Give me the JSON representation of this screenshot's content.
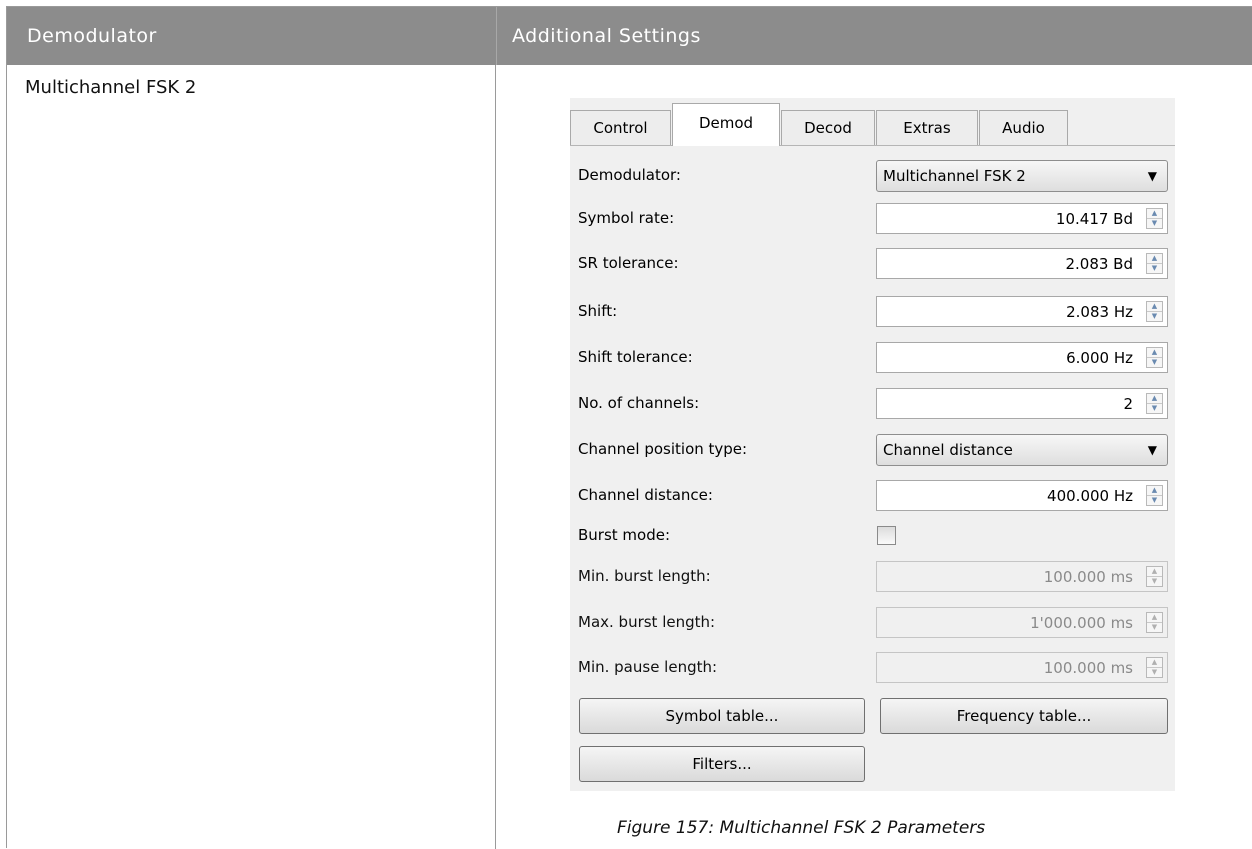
{
  "table": {
    "headers": [
      "Demodulator",
      "Additional Settings"
    ],
    "demodulator_name": "Multichannel FSK 2"
  },
  "tabs": [
    "Control",
    "Demod",
    "Decod",
    "Extras",
    "Audio"
  ],
  "active_tab": "Demod",
  "params": [
    {
      "label": "Demodulator:",
      "type": "combo",
      "value": "Multichannel FSK 2",
      "enabled": true
    },
    {
      "label": "Symbol rate:",
      "type": "spin",
      "value": "10.417 Bd",
      "enabled": true
    },
    {
      "label": "SR tolerance:",
      "type": "spin",
      "value": "2.083 Bd",
      "enabled": true
    },
    {
      "label": "Shift:",
      "type": "spin",
      "value": "2.083 Hz",
      "enabled": true
    },
    {
      "label": "Shift tolerance:",
      "type": "spin",
      "value": "6.000 Hz",
      "enabled": true
    },
    {
      "label": "No. of channels:",
      "type": "spin",
      "value": "2",
      "enabled": true
    },
    {
      "label": "Channel position type:",
      "type": "combo",
      "value": "Channel distance",
      "enabled": true
    },
    {
      "label": "Channel distance:",
      "type": "spin",
      "value": "400.000 Hz",
      "enabled": true
    },
    {
      "label": "Burst mode:",
      "type": "checkbox",
      "checked": false,
      "enabled": true
    },
    {
      "label": "Min. burst length:",
      "type": "spin",
      "value": "100.000 ms",
      "enabled": false
    },
    {
      "label": "Max. burst length:",
      "type": "spin",
      "value": "1'000.000 ms",
      "enabled": false
    },
    {
      "label": "Min. pause length:",
      "type": "spin",
      "value": "100.000 ms",
      "enabled": false
    }
  ],
  "buttons": {
    "symbol_table": "Symbol table...",
    "frequency_table": "Frequency table...",
    "filters": "Filters..."
  },
  "caption": "Figure 157: Multichannel FSK 2 Parameters"
}
